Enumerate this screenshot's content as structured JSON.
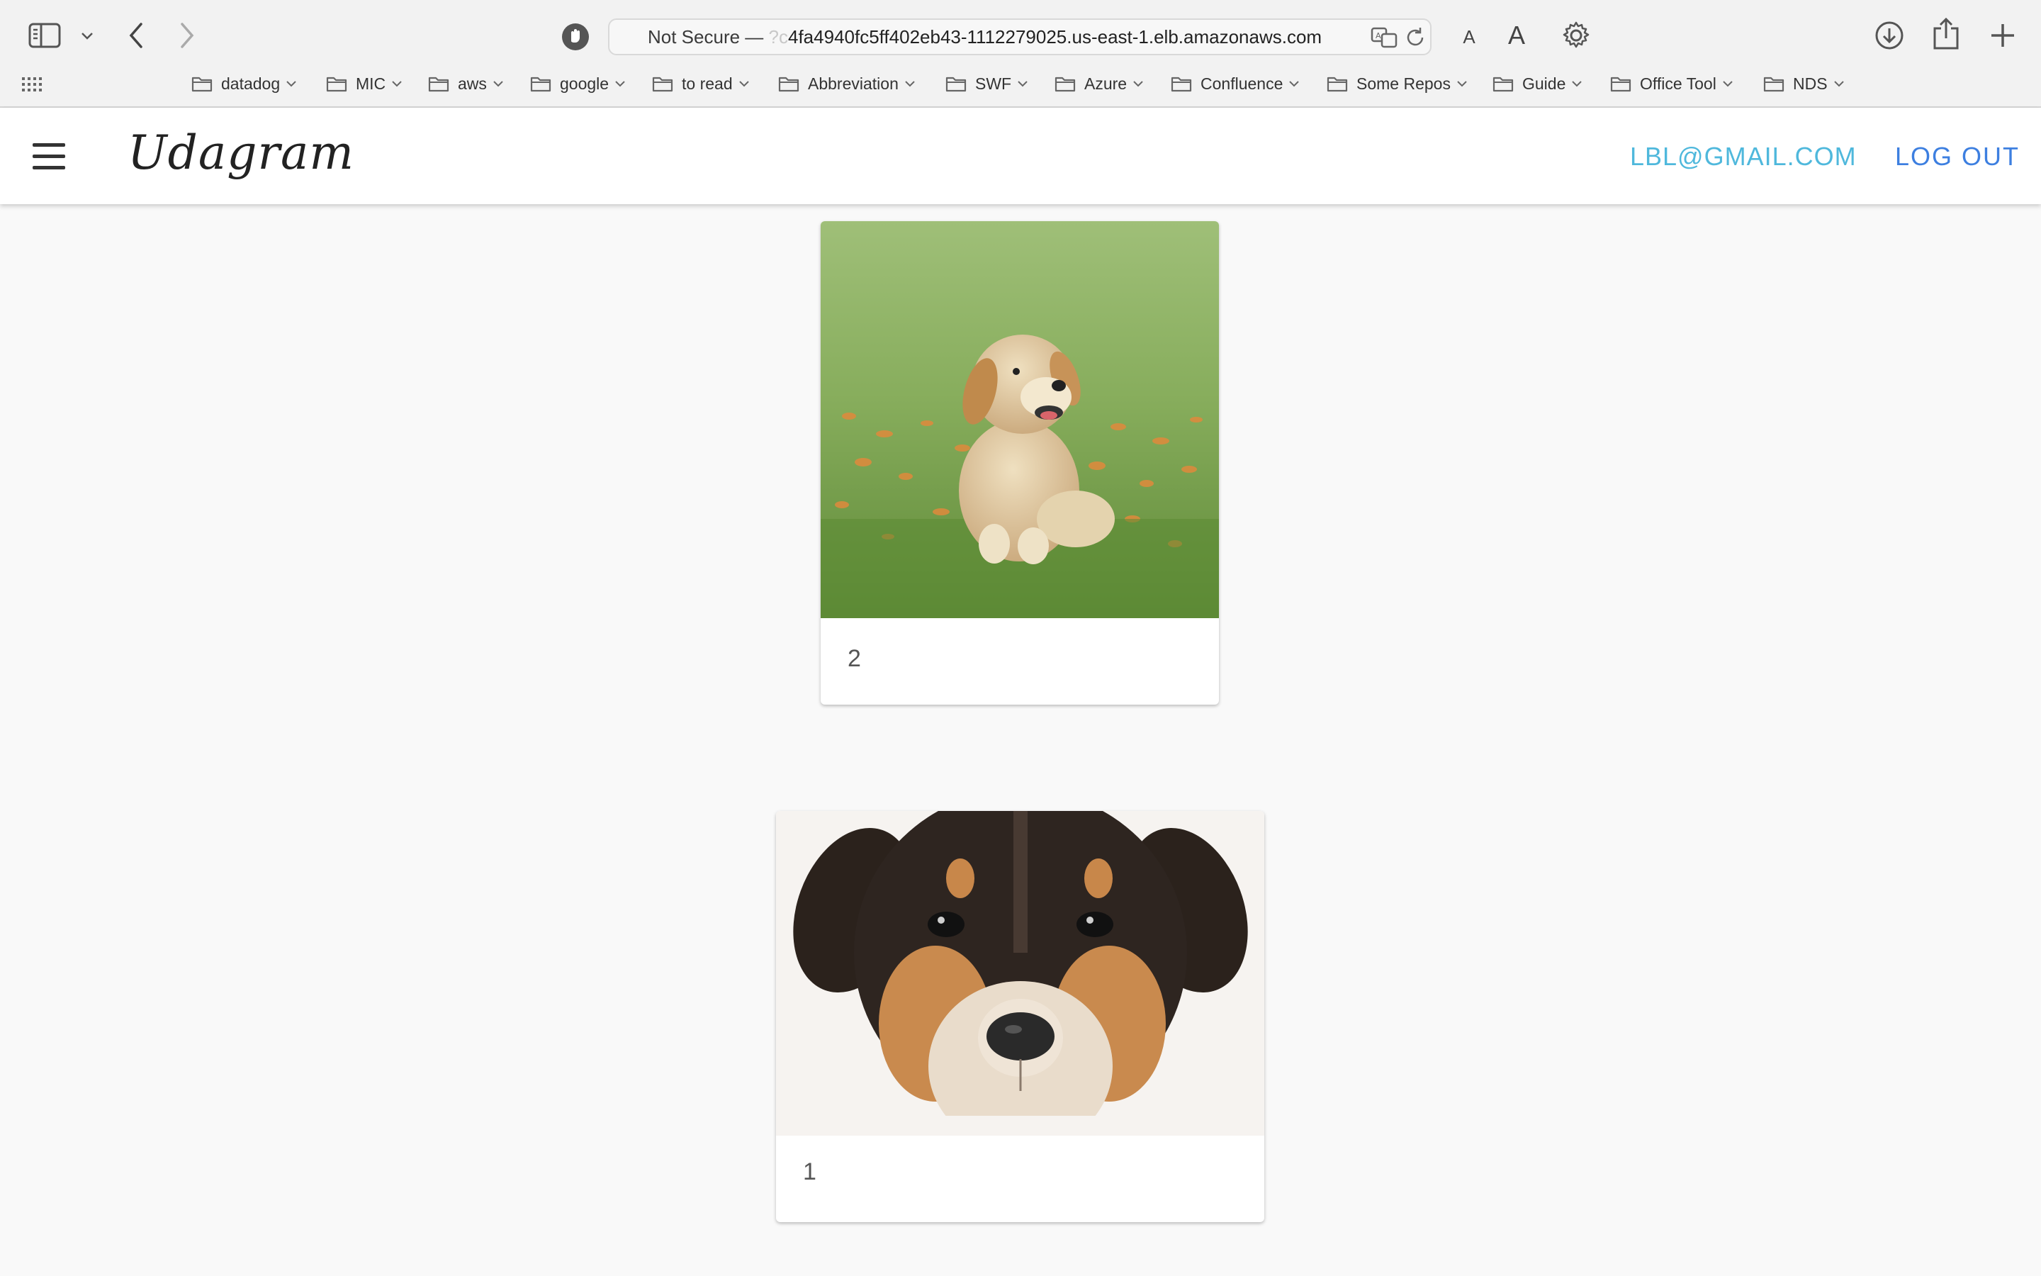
{
  "browser": {
    "url_prefix": "Not Secure —",
    "url_faded": "?c",
    "url_host": "4fa4940fc5ff402eb43-1112279025.us-east-1.elb.amazonaws.com",
    "text_size_small": "A",
    "text_size_large": "A",
    "bookmarks": [
      {
        "label": "datadog"
      },
      {
        "label": "MIC"
      },
      {
        "label": "aws"
      },
      {
        "label": "google"
      },
      {
        "label": "to read"
      },
      {
        "label": "Abbreviation"
      },
      {
        "label": "SWF"
      },
      {
        "label": "Azure"
      },
      {
        "label": "Confluence"
      },
      {
        "label": "Some Repos"
      },
      {
        "label": "Guide"
      },
      {
        "label": "Office Tool"
      },
      {
        "label": "NDS"
      }
    ]
  },
  "app": {
    "logo": "Udagram",
    "user_email": "LBL@GMAIL.COM",
    "logout_label": "LOG OUT"
  },
  "feed": {
    "items": [
      {
        "caption": "2",
        "image": "golden-puppy-photo"
      },
      {
        "caption": "1",
        "image": "black-tan-puppy-photo"
      }
    ]
  },
  "colors": {
    "email": "#4fb8dc",
    "logout": "#3d7fe0",
    "page_bg": "#f9f9f9"
  }
}
